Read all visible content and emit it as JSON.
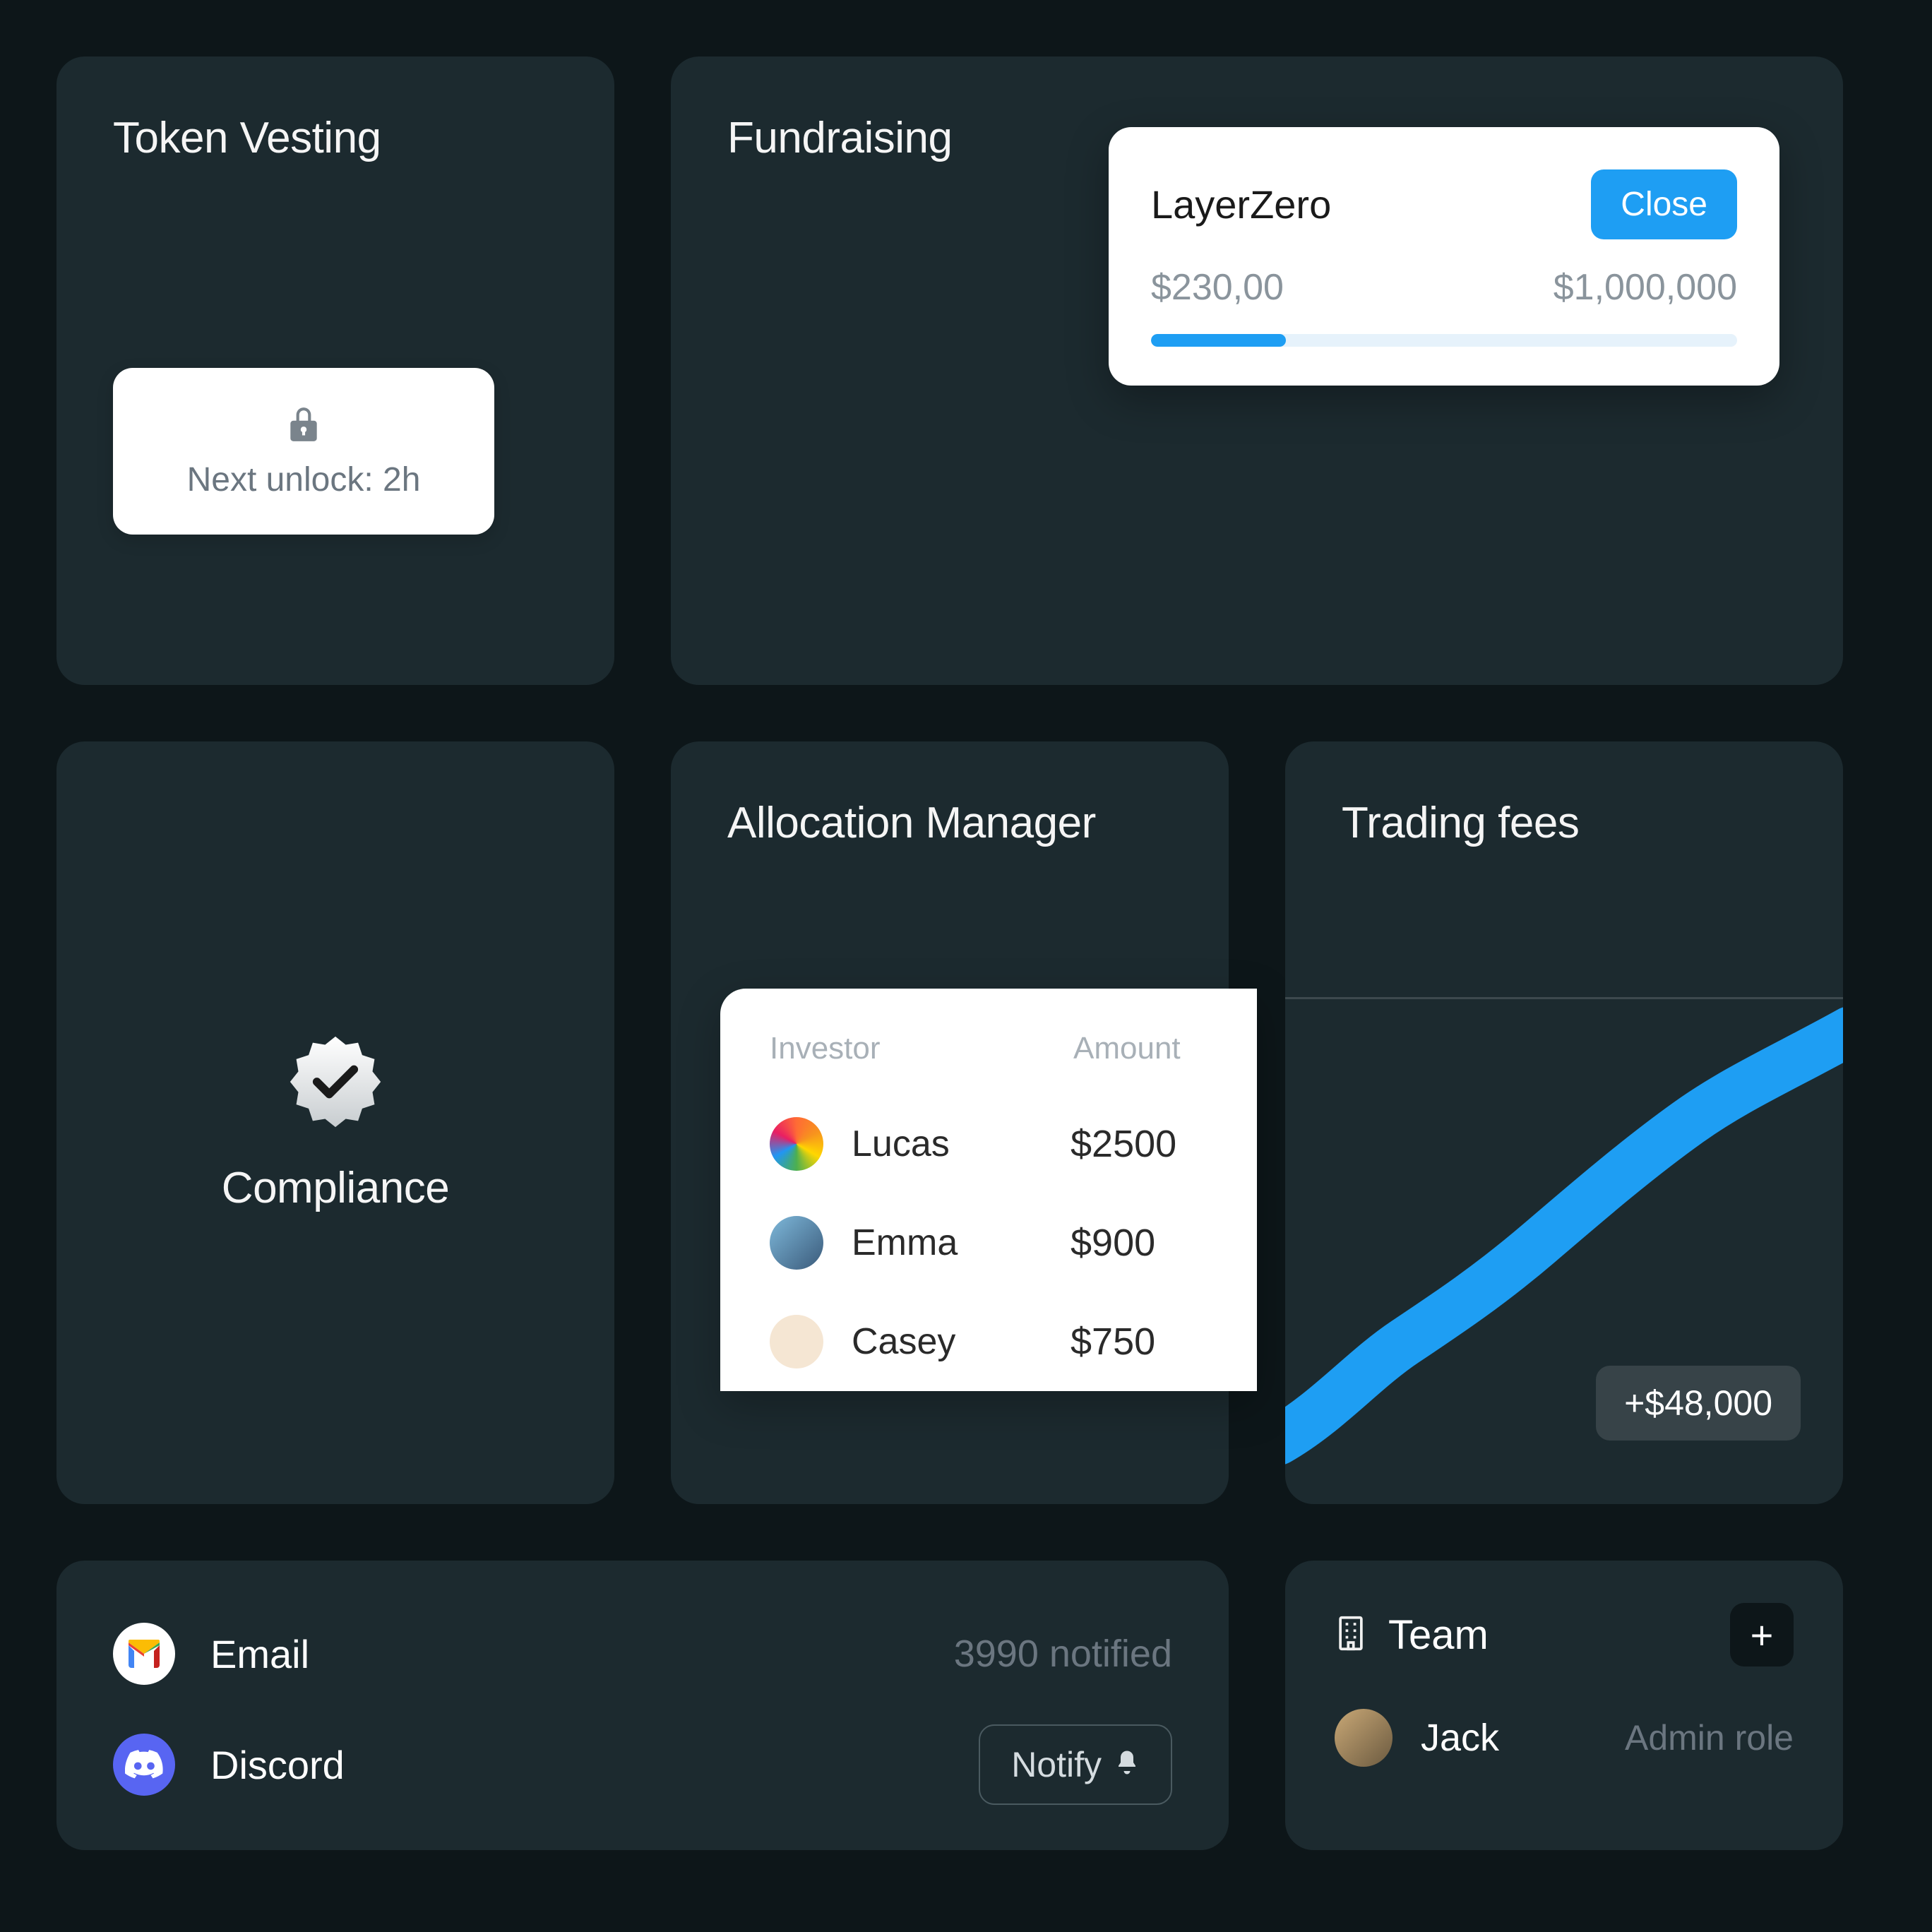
{
  "vesting": {
    "title": "Token Vesting",
    "unlock_label": "Next unlock: 2h"
  },
  "fundraising": {
    "title": "Fundraising",
    "project": "LayerZero",
    "close_label": "Close",
    "current": "$230,00",
    "target": "$1,000,000",
    "progress_pct": 23
  },
  "compliance": {
    "title": "Compliance"
  },
  "allocation": {
    "title": "Allocation Manager",
    "headers": {
      "investor": "Investor",
      "amount": "Amount"
    },
    "rows": [
      {
        "name": "Lucas",
        "amount": "$2500"
      },
      {
        "name": "Emma",
        "amount": "$900"
      },
      {
        "name": "Casey",
        "amount": "$750"
      }
    ]
  },
  "trading": {
    "title": "Trading fees",
    "delta": "+$48,000"
  },
  "notifications": {
    "email_label": "Email",
    "email_status": "3990 notified",
    "discord_label": "Discord",
    "notify_label": "Notify"
  },
  "team": {
    "title": "Team",
    "members": [
      {
        "name": "Jack",
        "role": "Admin role"
      }
    ]
  },
  "chart_data": {
    "type": "line",
    "title": "Trading fees",
    "x": [
      0,
      1,
      2,
      3,
      4,
      5,
      6,
      7,
      8
    ],
    "values": [
      5,
      12,
      20,
      28,
      37,
      45,
      52,
      56,
      62
    ],
    "ylim": [
      0,
      70
    ],
    "annotation": "+$48,000"
  }
}
